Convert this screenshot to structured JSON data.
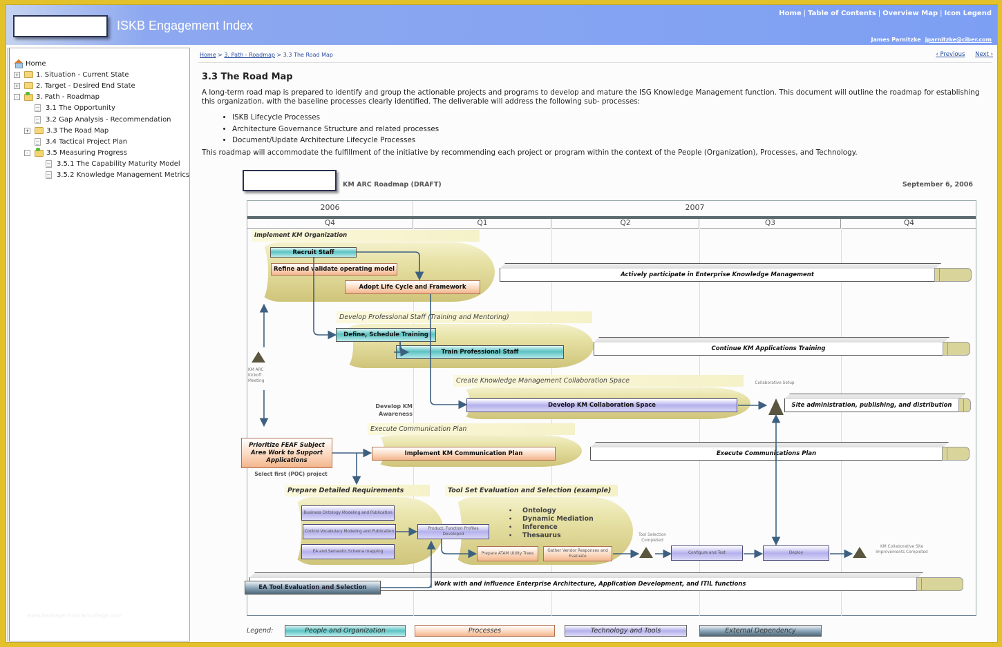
{
  "app": {
    "title": "ISKB Engagement Index",
    "nav": [
      "Home",
      "Table of Contents",
      "Overview Map",
      "Icon Legend"
    ],
    "user_name": "James Parnitzke",
    "user_email": "jparnitzke@ciber.com"
  },
  "sidebar": {
    "items": [
      {
        "label": "Home",
        "icon": "home-icon",
        "toggle": "",
        "level": 0
      },
      {
        "label": "1. Situation - Current State",
        "icon": "folder-icon",
        "toggle": "+",
        "level": 0
      },
      {
        "label": "2. Target - Desired End State",
        "icon": "folder-icon",
        "toggle": "+",
        "level": 0
      },
      {
        "label": "3. Path - Roadmap",
        "icon": "folder-open-icon",
        "toggle": "-",
        "level": 0
      },
      {
        "label": "3.1 The Opportunity",
        "icon": "page-icon",
        "toggle": "",
        "level": 1
      },
      {
        "label": "3.2 Gap Analysis - Recommendation",
        "icon": "page-icon",
        "toggle": "",
        "level": 1
      },
      {
        "label": "3.3 The Road Map",
        "icon": "folder-icon",
        "toggle": "+",
        "level": 1
      },
      {
        "label": "3.4 Tactical Project Plan",
        "icon": "page-icon",
        "toggle": "",
        "level": 1
      },
      {
        "label": "3.5 Measuring Progress",
        "icon": "folder-open-icon",
        "toggle": "-",
        "level": 1
      },
      {
        "label": "3.5.1 The Capability Maturity Model",
        "icon": "page-icon",
        "toggle": "",
        "level": 2
      },
      {
        "label": "3.5.2 Knowledge Management Metrics",
        "icon": "page-icon",
        "toggle": "",
        "level": 2
      }
    ],
    "watermark": "www.heritagechristiancollege.com"
  },
  "breadcrumb": {
    "items": [
      "Home",
      "3. Path - Roadmap",
      "3.3 The Road Map"
    ],
    "sep": ">"
  },
  "pager": {
    "previous": "‹ Previous",
    "next": "Next ›"
  },
  "page": {
    "title": "3.3 The Road Map",
    "intro": "A long-term road map is prepared to identify and group the actionable projects and programs to develop and mature the ISG Knowledge Management function. This document will outline the roadmap for establishing this organization, with the baseline processes clearly identified. The deliverable will address the following sub- processes:",
    "bullets": [
      "ISKB Lifecycle Processes",
      "Architecture Governance Structure and related processes",
      "Document/Update Architecture Lifecycle Processes"
    ],
    "outro": "This roadmap will accommodate the fulfillment of the initiative by recommending each project or program within the context of the People (Organization), Processes, and Technology."
  },
  "roadmap": {
    "title": "KM ARC Roadmap (DRAFT)",
    "date": "September 6, 2006",
    "years": [
      "2006",
      "2007"
    ],
    "quarters": [
      "Q4",
      "Q1",
      "Q2",
      "Q3",
      "Q4"
    ],
    "bands": {
      "implement_org": "Implement KM Organization",
      "develop_staff": "Develop Professional Staff (Training and Mentoring)",
      "collab_space": "Create Knowledge Management Collaboration Space",
      "comm_plan": "Execute Communication Plan",
      "requirements": "Prepare Detailed Requirements",
      "toolset": "Tool Set Evaluation and Selection (example)"
    },
    "tasks": {
      "recruit": "Recruit Staff",
      "refine": "Refine and  validate operating model",
      "adopt": "Adopt Life Cycle and Framework",
      "define_training": "Define, Schedule Training",
      "train_staff": "Train Professional Staff",
      "dev_collab": "Develop KM Collaboration Space",
      "prioritize": "Prioritize FEAF Subject Area Work to Support Applications",
      "implement_comm": "Implement KM Communication Plan",
      "ontology_model": "Business Ontology Modeling and Publication",
      "vocab_model": "Control Vocabulary Modeling and Publication",
      "ea_schema": "EA and Semantic Schema mapping",
      "profiles": "Product, Function Profiles Developed",
      "atam": "Prepare ATAM Utility Trees",
      "vendor": "Gather Vendor Responses and Evaluate",
      "configure": "Configure and Test",
      "deploy": "Deploy",
      "ea_tool": "EA Tool Evaluation and Selection"
    },
    "ongoing": {
      "participate": "Actively participate in Enterprise Knowledge Management",
      "continue_training": "Continue KM Applications Training",
      "site_admin": "Site administration, publishing, and distribution",
      "exec_comm": "Execute Communications Plan",
      "work_ea": "Work with and influence Enterprise Architecture, Application Development, and ITIL functions"
    },
    "toolset_bullets": [
      "Ontology",
      "Dynamic Mediation",
      "Inference",
      "Thesaurus"
    ],
    "milestones": {
      "kickoff": "KM ARC Kickoff Meeting",
      "collab_setup": "Collaborative Setup",
      "tool_selection": "Tool Selection Completed",
      "site_improvements": "KM Collaborative Site Improvements Completed"
    },
    "notes": {
      "awareness": "Develop KM Awareness",
      "select_poc": "Select first (POC) project"
    },
    "legend": {
      "label": "Legend:",
      "items": [
        "People and Organization",
        "Processes",
        "Technology and Tools",
        "External Dependency"
      ]
    }
  },
  "colors": {
    "header_blue": "#7d9ff3",
    "frame_gold": "#e2c12a",
    "people": "#5bc2c2",
    "process": "#f3b58c",
    "tech": "#b4b0ec",
    "external": "#6e8898",
    "band": "#e8e3a8",
    "arrow": "#3d6080",
    "milestone": "#5a5640"
  }
}
